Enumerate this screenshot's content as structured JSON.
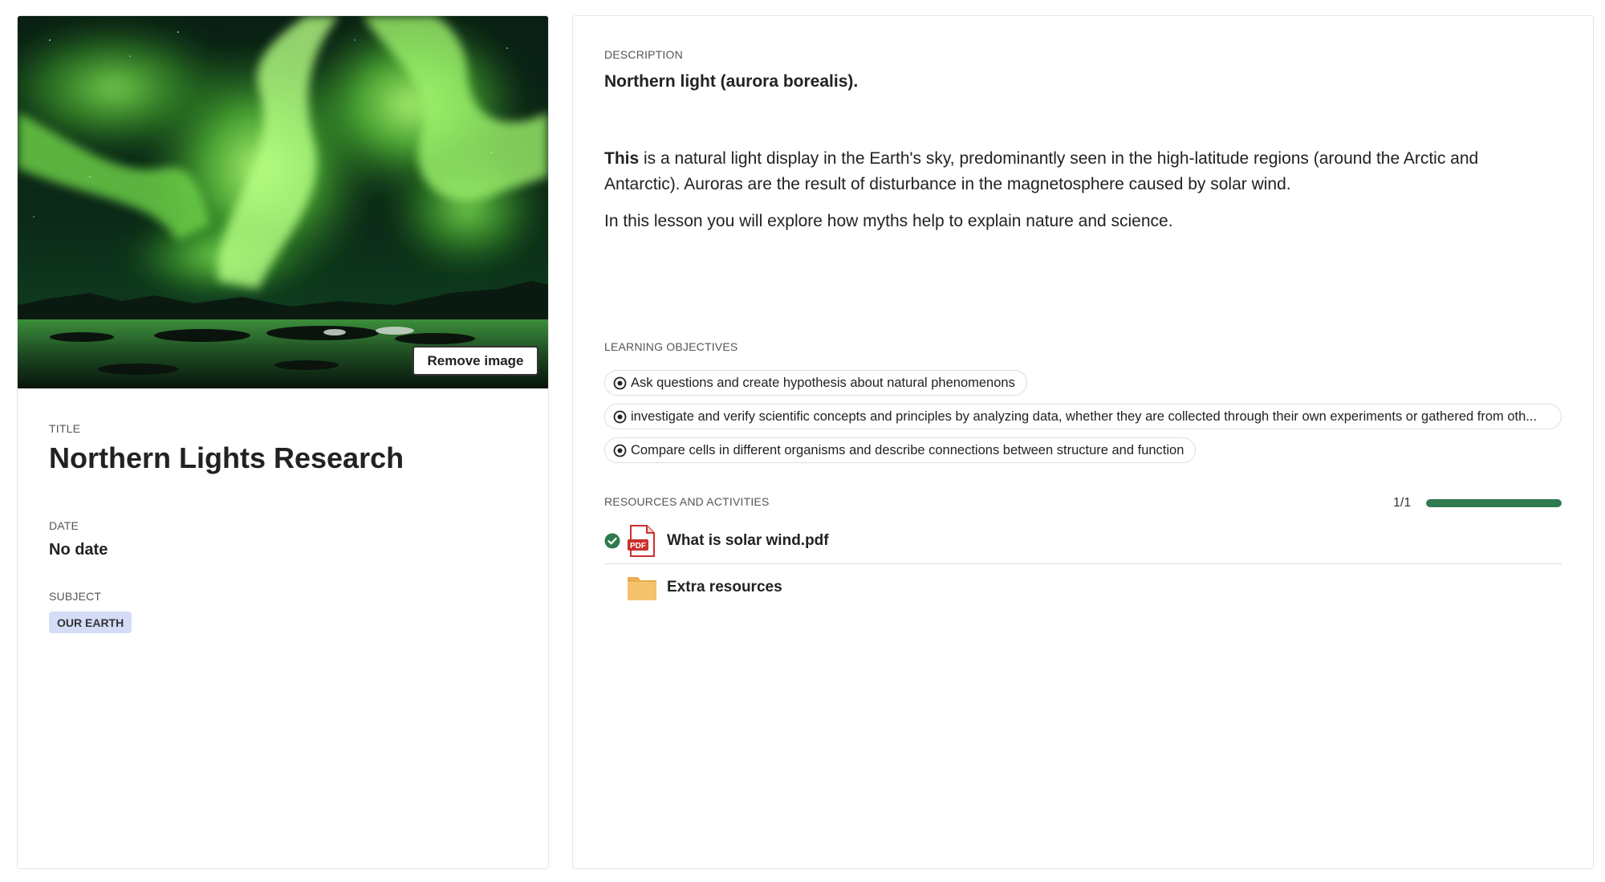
{
  "cover": {
    "remove_image_label": "Remove image"
  },
  "details": {
    "title_label": "TITLE",
    "title": "Northern Lights Research",
    "date_label": "DATE",
    "date": "No date",
    "subject_label": "SUBJECT",
    "subject": "OUR EARTH"
  },
  "description": {
    "label": "DESCRIPTION",
    "heading": "Northern light (aurora borealis).",
    "para1_bold": "This",
    "para1_rest": " is a natural light display in the Earth's sky, predominantly seen in the high-latitude regions (around the Arctic and Antarctic). Auroras are the result of disturbance in the magnetosphere caused by solar wind.",
    "para2": "In this lesson you will explore how myths help to explain nature and science."
  },
  "objectives": {
    "label": "LEARNING OBJECTIVES",
    "items": [
      "Ask questions and create hypothesis about natural phenomenons",
      "investigate and verify scientific concepts and principles by analyzing data, whether they are collected through their own experiments or gathered from oth...",
      "Compare cells in different organisms and describe connections between structure and function"
    ]
  },
  "resources": {
    "label": "RESOURCES AND ACTIVITIES",
    "progress_text": "1/1",
    "progress_fraction": 1.0,
    "items": [
      {
        "name": "What is solar wind.pdf",
        "icon": "pdf-file-icon",
        "completed": true
      },
      {
        "name": "Extra resources",
        "icon": "folder-icon",
        "completed": false
      }
    ]
  },
  "colors": {
    "accent_green": "#2f7a4f",
    "badge_bg": "#d4dcf7",
    "pdf_red": "#c9302c",
    "folder_yellow": "#f5c36b"
  }
}
